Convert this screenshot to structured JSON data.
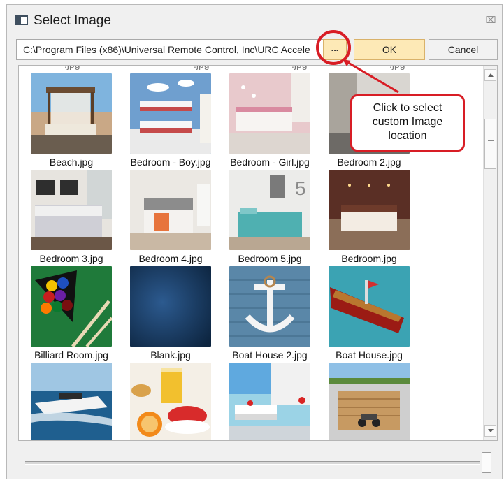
{
  "window": {
    "title": "Select Image"
  },
  "path": {
    "value": "C:\\Program Files (x86)\\Universal Remote Control, Inc\\URC Accele"
  },
  "buttons": {
    "browse": "...",
    "ok": "OK",
    "cancel": "Cancel"
  },
  "annotation": {
    "line1": "Click to select",
    "line2": "custom Image",
    "line3": "location"
  },
  "images": [
    {
      "name": "Beach.jpg",
      "thumb": "beach"
    },
    {
      "name": "Bedroom - Boy.jpg",
      "thumb": "bedroom-boy"
    },
    {
      "name": "Bedroom - Girl.jpg",
      "thumb": "bedroom-girl"
    },
    {
      "name": "Bedroom 2.jpg",
      "thumb": "bedroom-2"
    },
    {
      "name": "Bedroom 3.jpg",
      "thumb": "bedroom-3"
    },
    {
      "name": "Bedroom 4.jpg",
      "thumb": "bedroom-4"
    },
    {
      "name": "Bedroom 5.jpg",
      "thumb": "bedroom-5"
    },
    {
      "name": "Bedroom.jpg",
      "thumb": "bedroom"
    },
    {
      "name": "Billiard Room.jpg",
      "thumb": "billiard"
    },
    {
      "name": "Blank.jpg",
      "thumb": "blank"
    },
    {
      "name": "Boat House 2.jpg",
      "thumb": "boat-house-2"
    },
    {
      "name": "Boat House.jpg",
      "thumb": "boat-house"
    },
    {
      "name": "",
      "thumb": "yacht"
    },
    {
      "name": "",
      "thumb": "breakfast"
    },
    {
      "name": "",
      "thumb": "poolside"
    },
    {
      "name": "",
      "thumb": "garage"
    }
  ],
  "colors": {
    "accent": "#d81d25",
    "button_highlight": "#fde9b6"
  }
}
